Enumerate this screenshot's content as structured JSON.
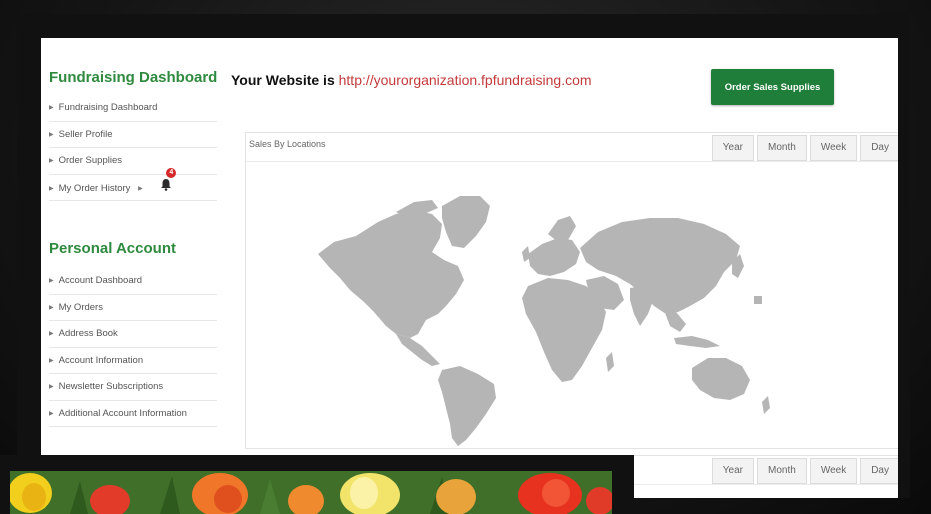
{
  "sidebar": {
    "fundraising_title": "Fundraising Dashboard",
    "fundraising_items": [
      {
        "label": "Fundraising Dashboard"
      },
      {
        "label": "Seller Profile"
      },
      {
        "label": "Order Supplies"
      },
      {
        "label": "My Order History",
        "badge": "4"
      }
    ],
    "personal_title": "Personal Account",
    "personal_items": [
      {
        "label": "Account Dashboard"
      },
      {
        "label": "My Orders"
      },
      {
        "label": "Address Book"
      },
      {
        "label": "Account Information"
      },
      {
        "label": "Newsletter Subscriptions"
      },
      {
        "label": "Additional Account Information"
      }
    ]
  },
  "header": {
    "website_label": "Your Website is ",
    "website_url": "http://yourorganization.fpfundraising.com",
    "order_button": "Order Sales Supplies"
  },
  "sales_panel": {
    "title": "Sales By Locations",
    "tabs": [
      "Year",
      "Month",
      "Week",
      "Day"
    ]
  },
  "second_panel": {
    "tabs": [
      "Year",
      "Month",
      "Week",
      "Day"
    ]
  },
  "colors": {
    "accent_green": "#2e8a3e",
    "button_green": "#1f7f3a",
    "url_red": "#c43a3a",
    "badge_red": "#d62828",
    "map_gray": "#b5b5b5"
  },
  "icons": {
    "arrow": "▸",
    "bell": "🔔"
  }
}
